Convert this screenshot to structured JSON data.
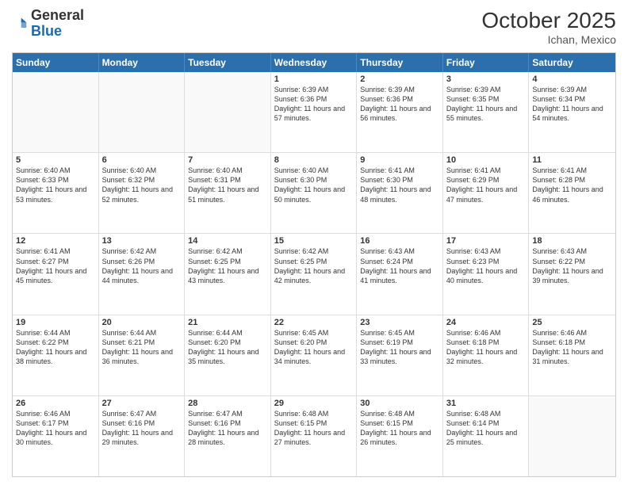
{
  "header": {
    "logo": {
      "general": "General",
      "blue": "Blue"
    },
    "title": "October 2025",
    "location": "Ichan, Mexico"
  },
  "calendar": {
    "days_of_week": [
      "Sunday",
      "Monday",
      "Tuesday",
      "Wednesday",
      "Thursday",
      "Friday",
      "Saturday"
    ],
    "rows": [
      [
        {
          "day": "",
          "empty": true
        },
        {
          "day": "",
          "empty": true
        },
        {
          "day": "",
          "empty": true
        },
        {
          "day": "1",
          "sunrise": "6:39 AM",
          "sunset": "6:36 PM",
          "daylight": "11 hours and 57 minutes."
        },
        {
          "day": "2",
          "sunrise": "6:39 AM",
          "sunset": "6:36 PM",
          "daylight": "11 hours and 56 minutes."
        },
        {
          "day": "3",
          "sunrise": "6:39 AM",
          "sunset": "6:35 PM",
          "daylight": "11 hours and 55 minutes."
        },
        {
          "day": "4",
          "sunrise": "6:39 AM",
          "sunset": "6:34 PM",
          "daylight": "11 hours and 54 minutes."
        }
      ],
      [
        {
          "day": "5",
          "sunrise": "6:40 AM",
          "sunset": "6:33 PM",
          "daylight": "11 hours and 53 minutes."
        },
        {
          "day": "6",
          "sunrise": "6:40 AM",
          "sunset": "6:32 PM",
          "daylight": "11 hours and 52 minutes."
        },
        {
          "day": "7",
          "sunrise": "6:40 AM",
          "sunset": "6:31 PM",
          "daylight": "11 hours and 51 minutes."
        },
        {
          "day": "8",
          "sunrise": "6:40 AM",
          "sunset": "6:30 PM",
          "daylight": "11 hours and 50 minutes."
        },
        {
          "day": "9",
          "sunrise": "6:41 AM",
          "sunset": "6:30 PM",
          "daylight": "11 hours and 48 minutes."
        },
        {
          "day": "10",
          "sunrise": "6:41 AM",
          "sunset": "6:29 PM",
          "daylight": "11 hours and 47 minutes."
        },
        {
          "day": "11",
          "sunrise": "6:41 AM",
          "sunset": "6:28 PM",
          "daylight": "11 hours and 46 minutes."
        }
      ],
      [
        {
          "day": "12",
          "sunrise": "6:41 AM",
          "sunset": "6:27 PM",
          "daylight": "11 hours and 45 minutes."
        },
        {
          "day": "13",
          "sunrise": "6:42 AM",
          "sunset": "6:26 PM",
          "daylight": "11 hours and 44 minutes."
        },
        {
          "day": "14",
          "sunrise": "6:42 AM",
          "sunset": "6:25 PM",
          "daylight": "11 hours and 43 minutes."
        },
        {
          "day": "15",
          "sunrise": "6:42 AM",
          "sunset": "6:25 PM",
          "daylight": "11 hours and 42 minutes."
        },
        {
          "day": "16",
          "sunrise": "6:43 AM",
          "sunset": "6:24 PM",
          "daylight": "11 hours and 41 minutes."
        },
        {
          "day": "17",
          "sunrise": "6:43 AM",
          "sunset": "6:23 PM",
          "daylight": "11 hours and 40 minutes."
        },
        {
          "day": "18",
          "sunrise": "6:43 AM",
          "sunset": "6:22 PM",
          "daylight": "11 hours and 39 minutes."
        }
      ],
      [
        {
          "day": "19",
          "sunrise": "6:44 AM",
          "sunset": "6:22 PM",
          "daylight": "11 hours and 38 minutes."
        },
        {
          "day": "20",
          "sunrise": "6:44 AM",
          "sunset": "6:21 PM",
          "daylight": "11 hours and 36 minutes."
        },
        {
          "day": "21",
          "sunrise": "6:44 AM",
          "sunset": "6:20 PM",
          "daylight": "11 hours and 35 minutes."
        },
        {
          "day": "22",
          "sunrise": "6:45 AM",
          "sunset": "6:20 PM",
          "daylight": "11 hours and 34 minutes."
        },
        {
          "day": "23",
          "sunrise": "6:45 AM",
          "sunset": "6:19 PM",
          "daylight": "11 hours and 33 minutes."
        },
        {
          "day": "24",
          "sunrise": "6:46 AM",
          "sunset": "6:18 PM",
          "daylight": "11 hours and 32 minutes."
        },
        {
          "day": "25",
          "sunrise": "6:46 AM",
          "sunset": "6:18 PM",
          "daylight": "11 hours and 31 minutes."
        }
      ],
      [
        {
          "day": "26",
          "sunrise": "6:46 AM",
          "sunset": "6:17 PM",
          "daylight": "11 hours and 30 minutes."
        },
        {
          "day": "27",
          "sunrise": "6:47 AM",
          "sunset": "6:16 PM",
          "daylight": "11 hours and 29 minutes."
        },
        {
          "day": "28",
          "sunrise": "6:47 AM",
          "sunset": "6:16 PM",
          "daylight": "11 hours and 28 minutes."
        },
        {
          "day": "29",
          "sunrise": "6:48 AM",
          "sunset": "6:15 PM",
          "daylight": "11 hours and 27 minutes."
        },
        {
          "day": "30",
          "sunrise": "6:48 AM",
          "sunset": "6:15 PM",
          "daylight": "11 hours and 26 minutes."
        },
        {
          "day": "31",
          "sunrise": "6:48 AM",
          "sunset": "6:14 PM",
          "daylight": "11 hours and 25 minutes."
        },
        {
          "day": "",
          "empty": true
        }
      ]
    ]
  }
}
